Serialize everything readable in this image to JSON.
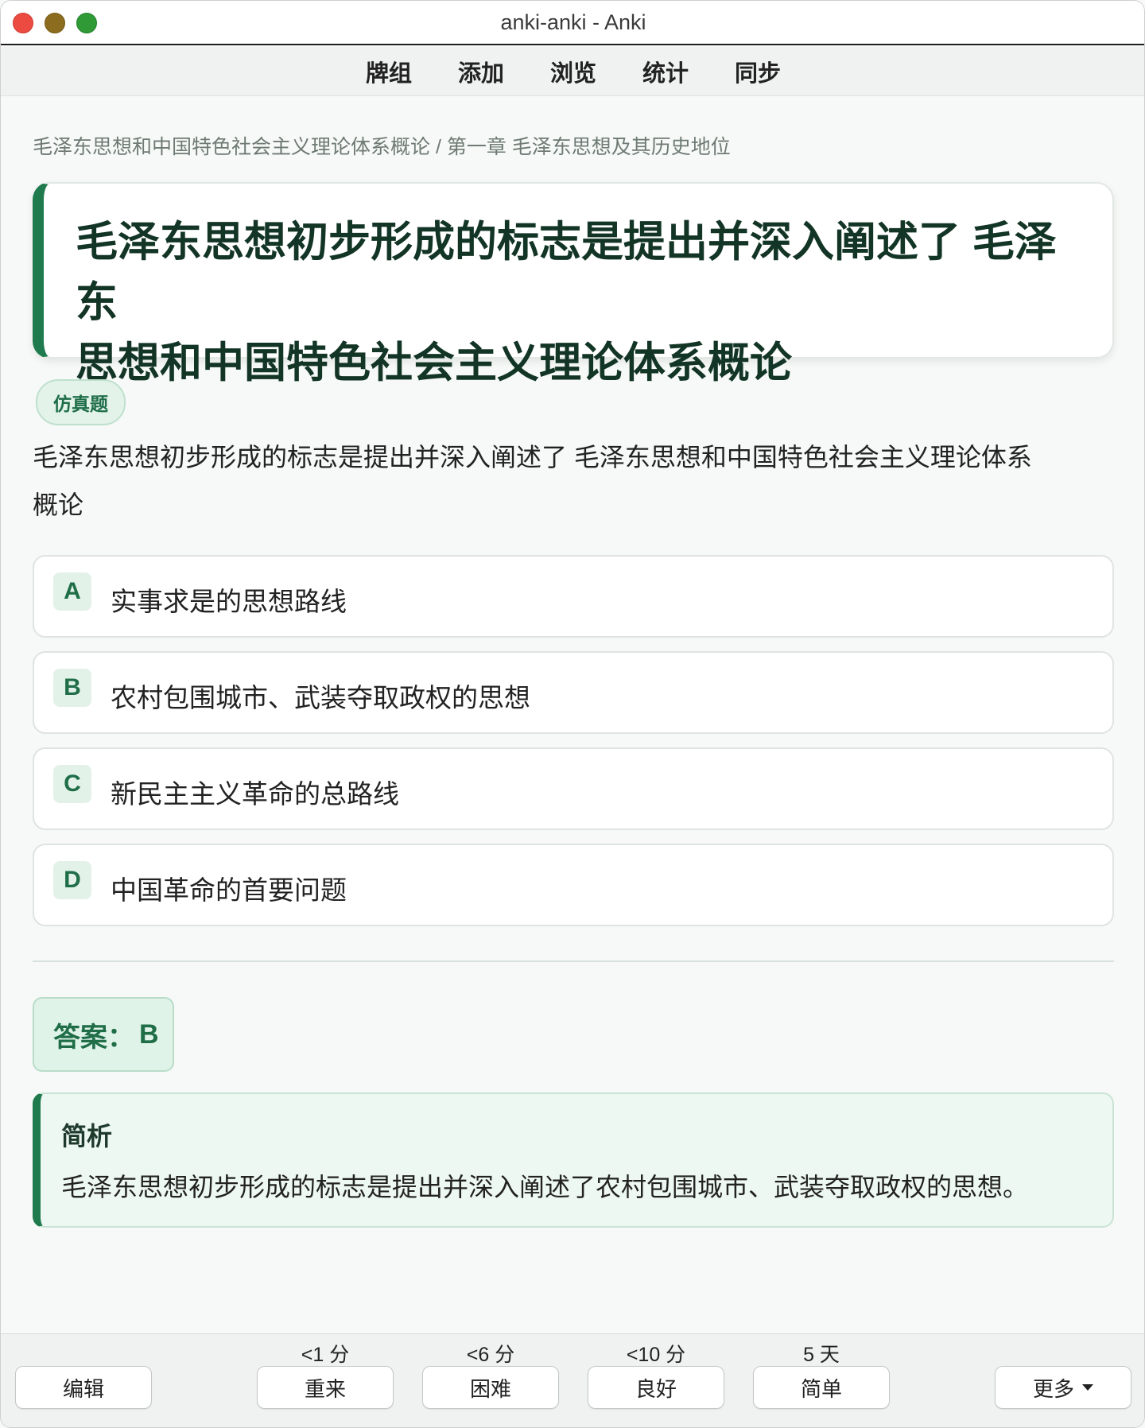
{
  "window": {
    "title": "anki-anki - Anki"
  },
  "toolbar": {
    "items": [
      "牌组",
      "添加",
      "浏览",
      "统计",
      "同步"
    ]
  },
  "breadcrumb": "毛泽东思想和中国特色社会主义理论体系概论 / 第一章 毛泽东思想及其历史地位",
  "card": {
    "title_line1": "毛泽东思想初步形成的标志是提出并深入阐述了 毛泽东",
    "title_line2": "思想和中国特色社会主义理论体系概论"
  },
  "tag": "仿真题",
  "question": {
    "line1": "毛泽东思想初步形成的标志是提出并深入阐述了 毛泽东思想和中国特色社会主义理论体系",
    "line2": "概论"
  },
  "options": [
    {
      "letter": "A",
      "text": "实事求是的思想路线"
    },
    {
      "letter": "B",
      "text": "农村包围城市、武装夺取政权的思想"
    },
    {
      "letter": "C",
      "text": "新民主主义革命的总路线"
    },
    {
      "letter": "D",
      "text": "中国革命的首要问题"
    }
  ],
  "answer": {
    "label": "答案：",
    "value": "B"
  },
  "analysis": {
    "title": "简析",
    "text": "毛泽东思想初步形成的标志是提出并深入阐述了农村包围城市、武装夺取政权的思想。"
  },
  "bottom": {
    "edit_label": "编辑",
    "ease_buttons": [
      {
        "time": "<1 分",
        "label": "重来"
      },
      {
        "time": "<6 分",
        "label": "困难"
      },
      {
        "time": "<10 分",
        "label": "良好"
      },
      {
        "time": "5 天",
        "label": "简单"
      }
    ],
    "more_label": "更多"
  },
  "colors": {
    "accent": "#1f7a4e",
    "accent_light": "#e2f2e8",
    "title_text": "#133526"
  },
  "icons": [
    "close-icon",
    "minimize-icon",
    "zoom-icon",
    "chevron-down-icon"
  ]
}
